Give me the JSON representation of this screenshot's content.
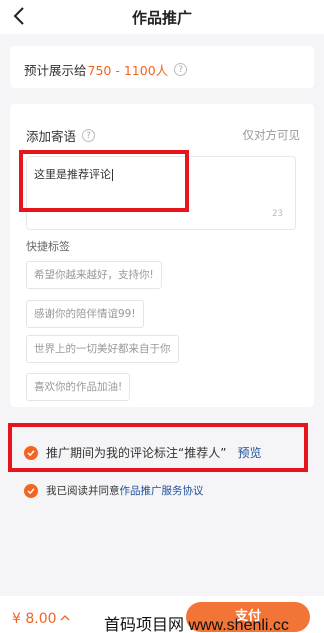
{
  "header": {
    "title": "作品推广"
  },
  "estimate": {
    "prefix": "预计展示给",
    "range": "750 - 1100人"
  },
  "message": {
    "title": "添加寄语",
    "visibility": "仅对方可见",
    "textarea_value": "这里是推荐评论",
    "counter": "23"
  },
  "tags": {
    "label": "快捷标签",
    "items": [
      "希望你越来越好，支持你!",
      "感谢你的陪伴情谊99!",
      "世界上的一切美好都来自于你",
      "喜欢你的作品加油!"
    ]
  },
  "options": {
    "recommend_text": "推广期间为我的评论标注“推荐人”",
    "preview_link": "预览",
    "agree_text": "我已阅读并同意",
    "agreement_link": "作品推广服务协议"
  },
  "bottom": {
    "price": "¥ 8.00",
    "pay_label": "支付"
  },
  "watermark": "首码项目网 www.shenli.cc",
  "colors": {
    "accent": "#f26522",
    "link": "#1f4e9a",
    "highlight": "#e8141b"
  }
}
